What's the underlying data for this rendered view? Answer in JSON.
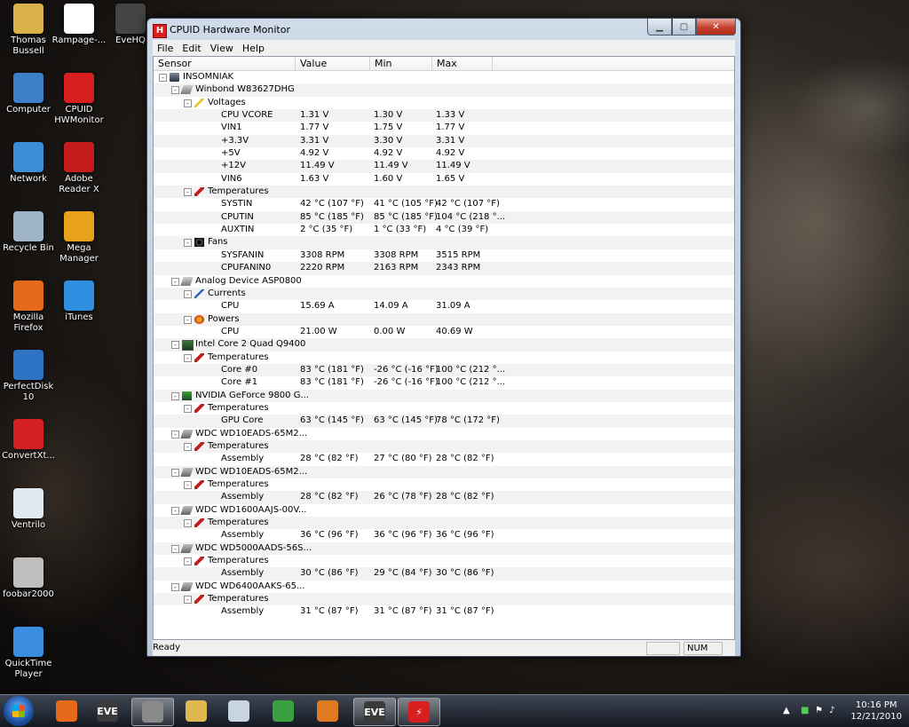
{
  "desktop": {
    "icons": [
      {
        "label": "Thomas Bussell",
        "icon": "folder-user-icon",
        "color": "#d9b24a"
      },
      {
        "label": "Rampage-...",
        "icon": "document-icon",
        "color": "#ffffff"
      },
      {
        "label": "EveHQ",
        "icon": "evehq-icon",
        "color": "#444444"
      },
      {
        "label": "Computer",
        "icon": "computer-icon",
        "color": "#3d7fc9"
      },
      {
        "label": "CPUID HWMonitor",
        "icon": "hwmonitor-icon",
        "color": "#d81e1e"
      },
      {
        "label": "Network",
        "icon": "network-icon",
        "color": "#3a8fd8"
      },
      {
        "label": "Adobe Reader X",
        "icon": "adobe-reader-icon",
        "color": "#c61c1c"
      },
      {
        "label": "Recycle Bin",
        "icon": "recycle-bin-icon",
        "color": "#9fb3c8"
      },
      {
        "label": "Mega Manager",
        "icon": "mega-manager-icon",
        "color": "#e8a21a"
      },
      {
        "label": "Mozilla Firefox",
        "icon": "firefox-icon",
        "color": "#e66a1a"
      },
      {
        "label": "iTunes",
        "icon": "itunes-icon",
        "color": "#2f8fe0"
      },
      {
        "label": "PerfectDisk 10",
        "icon": "perfectdisk-icon",
        "color": "#2f73c4"
      },
      {
        "label": "ConvertXt...",
        "icon": "convertx-icon",
        "color": "#d42020"
      },
      {
        "label": "Ventrilo",
        "icon": "ventrilo-icon",
        "color": "#e0e8f0"
      },
      {
        "label": "foobar2000",
        "icon": "foobar-icon",
        "color": "#bfbfbf"
      },
      {
        "label": "QuickTime Player",
        "icon": "quicktime-icon",
        "color": "#3a8de0"
      }
    ]
  },
  "window": {
    "title": "CPUID Hardware Monitor",
    "app_icon_letter": "H",
    "menu": [
      "File",
      "Edit",
      "View",
      "Help"
    ],
    "columns": [
      "Sensor",
      "Value",
      "Min",
      "Max"
    ],
    "status": "Ready",
    "status_num": "NUM",
    "accent": "#d81e1e"
  },
  "rows": [
    {
      "level": 0,
      "toggle": "-",
      "icon": "computer-icon",
      "name": "INSOMNIAK",
      "value": "",
      "min": "",
      "max": ""
    },
    {
      "level": 1,
      "toggle": "-",
      "icon": "chip-icon",
      "name": "Winbond W83627DHG",
      "value": "",
      "min": "",
      "max": ""
    },
    {
      "level": 2,
      "toggle": "-",
      "icon": "voltage-icon",
      "name": "Voltages",
      "value": "",
      "min": "",
      "max": ""
    },
    {
      "level": 3,
      "toggle": "",
      "icon": "",
      "name": "CPU VCORE",
      "value": "1.31 V",
      "min": "1.30 V",
      "max": "1.33 V"
    },
    {
      "level": 3,
      "toggle": "",
      "icon": "",
      "name": "VIN1",
      "value": "1.77 V",
      "min": "1.75 V",
      "max": "1.77 V"
    },
    {
      "level": 3,
      "toggle": "",
      "icon": "",
      "name": "+3.3V",
      "value": "3.31 V",
      "min": "3.30 V",
      "max": "3.31 V"
    },
    {
      "level": 3,
      "toggle": "",
      "icon": "",
      "name": "+5V",
      "value": "4.92 V",
      "min": "4.92 V",
      "max": "4.92 V"
    },
    {
      "level": 3,
      "toggle": "",
      "icon": "",
      "name": "+12V",
      "value": "11.49 V",
      "min": "11.49 V",
      "max": "11.49 V"
    },
    {
      "level": 3,
      "toggle": "",
      "icon": "",
      "name": "VIN6",
      "value": "1.63 V",
      "min": "1.60 V",
      "max": "1.65 V"
    },
    {
      "level": 2,
      "toggle": "-",
      "icon": "thermometer-icon",
      "name": "Temperatures",
      "value": "",
      "min": "",
      "max": ""
    },
    {
      "level": 3,
      "toggle": "",
      "icon": "",
      "name": "SYSTIN",
      "value": "42 °C  (107 °F)",
      "min": "41 °C  (105 °F)",
      "max": "42 °C  (107 °F)"
    },
    {
      "level": 3,
      "toggle": "",
      "icon": "",
      "name": "CPUTIN",
      "value": "85 °C  (185 °F)",
      "min": "85 °C  (185 °F)",
      "max": "104 °C  (218 °..."
    },
    {
      "level": 3,
      "toggle": "",
      "icon": "",
      "name": "AUXTIN",
      "value": "2 °C  (35 °F)",
      "min": "1 °C  (33 °F)",
      "max": "4 °C  (39 °F)"
    },
    {
      "level": 2,
      "toggle": "-",
      "icon": "fan-icon",
      "name": "Fans",
      "value": "",
      "min": "",
      "max": ""
    },
    {
      "level": 3,
      "toggle": "",
      "icon": "",
      "name": "SYSFANIN",
      "value": "3308 RPM",
      "min": "3308 RPM",
      "max": "3515 RPM"
    },
    {
      "level": 3,
      "toggle": "",
      "icon": "",
      "name": "CPUFANIN0",
      "value": "2220 RPM",
      "min": "2163 RPM",
      "max": "2343 RPM"
    },
    {
      "level": 1,
      "toggle": "-",
      "icon": "chip-icon",
      "name": "Analog Device ASP0800",
      "value": "",
      "min": "",
      "max": ""
    },
    {
      "level": 2,
      "toggle": "-",
      "icon": "current-icon",
      "name": "Currents",
      "value": "",
      "min": "",
      "max": ""
    },
    {
      "level": 3,
      "toggle": "",
      "icon": "",
      "name": "CPU",
      "value": "15.69 A",
      "min": "14.09 A",
      "max": "31.09 A"
    },
    {
      "level": 2,
      "toggle": "-",
      "icon": "power-icon",
      "name": "Powers",
      "value": "",
      "min": "",
      "max": ""
    },
    {
      "level": 3,
      "toggle": "",
      "icon": "",
      "name": "CPU",
      "value": "21.00 W",
      "min": "0.00 W",
      "max": "40.69 W"
    },
    {
      "level": 1,
      "toggle": "-",
      "icon": "cpu-icon",
      "name": "Intel Core 2 Quad Q9400",
      "value": "",
      "min": "",
      "max": ""
    },
    {
      "level": 2,
      "toggle": "-",
      "icon": "thermometer-icon",
      "name": "Temperatures",
      "value": "",
      "min": "",
      "max": ""
    },
    {
      "level": 3,
      "toggle": "",
      "icon": "",
      "name": "Core #0",
      "value": "83 °C  (181 °F)",
      "min": "-26 °C  (-16 °F)",
      "max": "100 °C  (212 °..."
    },
    {
      "level": 3,
      "toggle": "",
      "icon": "",
      "name": "Core #1",
      "value": "83 °C  (181 °F)",
      "min": "-26 °C  (-16 °F)",
      "max": "100 °C  (212 °..."
    },
    {
      "level": 1,
      "toggle": "-",
      "icon": "gpu-icon",
      "name": "NVIDIA GeForce 9800 G...",
      "value": "",
      "min": "",
      "max": ""
    },
    {
      "level": 2,
      "toggle": "-",
      "icon": "thermometer-icon",
      "name": "Temperatures",
      "value": "",
      "min": "",
      "max": ""
    },
    {
      "level": 3,
      "toggle": "",
      "icon": "",
      "name": "GPU Core",
      "value": "63 °C  (145 °F)",
      "min": "63 °C  (145 °F)",
      "max": "78 °C  (172 °F)"
    },
    {
      "level": 1,
      "toggle": "-",
      "icon": "hard-drive-icon",
      "name": "WDC WD10EADS-65M2...",
      "value": "",
      "min": "",
      "max": ""
    },
    {
      "level": 2,
      "toggle": "-",
      "icon": "thermometer-icon",
      "name": "Temperatures",
      "value": "",
      "min": "",
      "max": ""
    },
    {
      "level": 3,
      "toggle": "",
      "icon": "",
      "name": "Assembly",
      "value": "28 °C  (82 °F)",
      "min": "27 °C  (80 °F)",
      "max": "28 °C  (82 °F)"
    },
    {
      "level": 1,
      "toggle": "-",
      "icon": "hard-drive-icon",
      "name": "WDC WD10EADS-65M2...",
      "value": "",
      "min": "",
      "max": ""
    },
    {
      "level": 2,
      "toggle": "-",
      "icon": "thermometer-icon",
      "name": "Temperatures",
      "value": "",
      "min": "",
      "max": ""
    },
    {
      "level": 3,
      "toggle": "",
      "icon": "",
      "name": "Assembly",
      "value": "28 °C  (82 °F)",
      "min": "26 °C  (78 °F)",
      "max": "28 °C  (82 °F)"
    },
    {
      "level": 1,
      "toggle": "-",
      "icon": "hard-drive-icon",
      "name": "WDC WD1600AAJS-00V...",
      "value": "",
      "min": "",
      "max": ""
    },
    {
      "level": 2,
      "toggle": "-",
      "icon": "thermometer-icon",
      "name": "Temperatures",
      "value": "",
      "min": "",
      "max": ""
    },
    {
      "level": 3,
      "toggle": "",
      "icon": "",
      "name": "Assembly",
      "value": "36 °C  (96 °F)",
      "min": "36 °C  (96 °F)",
      "max": "36 °C  (96 °F)"
    },
    {
      "level": 1,
      "toggle": "-",
      "icon": "hard-drive-icon",
      "name": "WDC WD5000AADS-56S...",
      "value": "",
      "min": "",
      "max": ""
    },
    {
      "level": 2,
      "toggle": "-",
      "icon": "thermometer-icon",
      "name": "Temperatures",
      "value": "",
      "min": "",
      "max": ""
    },
    {
      "level": 3,
      "toggle": "",
      "icon": "",
      "name": "Assembly",
      "value": "30 °C  (86 °F)",
      "min": "29 °C  (84 °F)",
      "max": "30 °C  (86 °F)"
    },
    {
      "level": 1,
      "toggle": "-",
      "icon": "hard-drive-icon",
      "name": "WDC WD6400AAKS-65...",
      "value": "",
      "min": "",
      "max": ""
    },
    {
      "level": 2,
      "toggle": "-",
      "icon": "thermometer-icon",
      "name": "Temperatures",
      "value": "",
      "min": "",
      "max": ""
    },
    {
      "level": 3,
      "toggle": "",
      "icon": "",
      "name": "Assembly",
      "value": "31 °C  (87 °F)",
      "min": "31 °C  (87 °F)",
      "max": "31 °C  (87 °F)"
    }
  ],
  "taskbar": {
    "buttons": [
      {
        "icon": "firefox-icon",
        "color": "#e66a1a",
        "active": false,
        "glyph": ""
      },
      {
        "icon": "evehq-icon",
        "color": "#3a3a3a",
        "active": false,
        "glyph": "EVE"
      },
      {
        "icon": "foobar-icon",
        "color": "#8a8a8a",
        "active": true,
        "glyph": ""
      },
      {
        "icon": "explorer-icon",
        "color": "#e0b850",
        "active": false,
        "glyph": ""
      },
      {
        "icon": "ventrilo-icon",
        "color": "#c8d4e0",
        "active": false,
        "glyph": ""
      },
      {
        "icon": "messenger-icon",
        "color": "#3aa040",
        "active": false,
        "glyph": ""
      },
      {
        "icon": "media-player-icon",
        "color": "#e07a20",
        "active": false,
        "glyph": ""
      },
      {
        "icon": "evehq-icon",
        "color": "#3a3a3a",
        "active": true,
        "glyph": "EVE"
      },
      {
        "icon": "hwmonitor-icon",
        "color": "#d81e1e",
        "active": true,
        "glyph": "⚡"
      }
    ],
    "clock_time": "10:16 PM",
    "clock_date": "12/21/2010"
  }
}
